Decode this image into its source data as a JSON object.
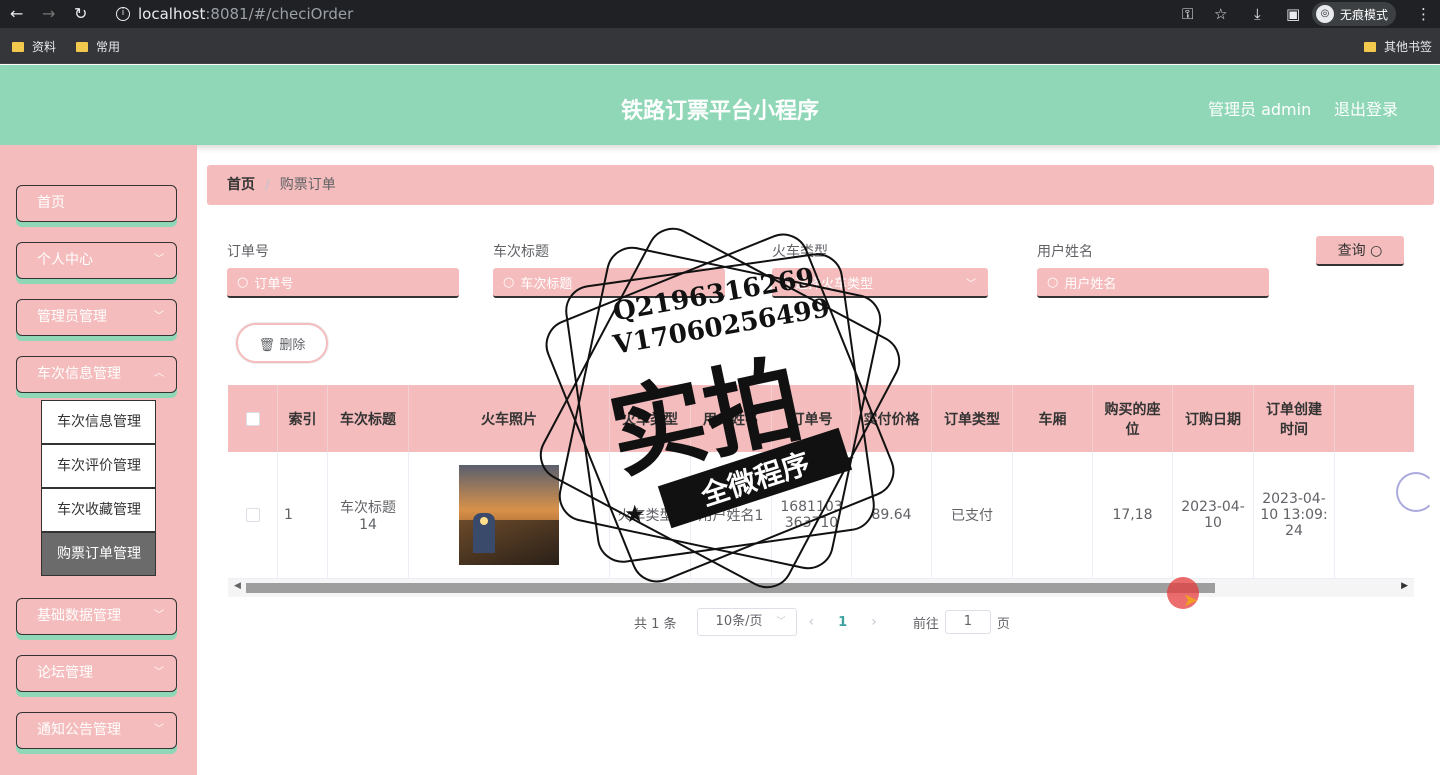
{
  "browser": {
    "url_host": "localhost",
    "url_path": ":8081/#/checiOrder",
    "incognito_label": "无痕模式",
    "bookmarks": [
      "资料",
      "常用"
    ],
    "other_bookmarks": "其他书签"
  },
  "header": {
    "title": "铁路订票平台小程序",
    "admin": "管理员 admin",
    "logout": "退出登录"
  },
  "sidebar": {
    "items": [
      {
        "label": "首页"
      },
      {
        "label": "个人中心"
      },
      {
        "label": "管理员管理"
      },
      {
        "label": "车次信息管理"
      },
      {
        "label": "基础数据管理"
      },
      {
        "label": "论坛管理"
      },
      {
        "label": "通知公告管理"
      }
    ],
    "submenu": [
      "车次信息管理",
      "车次评价管理",
      "车次收藏管理",
      "购票订单管理"
    ]
  },
  "breadcrumb": {
    "home": "首页",
    "current": "购票订单"
  },
  "filters": {
    "order_no": {
      "label": "订单号",
      "placeholder": "订单号"
    },
    "train_title": {
      "label": "车次标题",
      "placeholder": "车次标题"
    },
    "train_type": {
      "label": "火车类型",
      "placeholder": "请选择火车类型"
    },
    "user_name": {
      "label": "用户姓名",
      "placeholder": "用户姓名"
    },
    "search_label": "查询"
  },
  "actions": {
    "delete_label": "删除"
  },
  "table": {
    "columns": [
      "索引",
      "车次标题",
      "火车照片",
      "火车类型",
      "用户姓名",
      "订单号",
      "实付价格",
      "订单类型",
      "车厢",
      "购买的座位",
      "订购日期",
      "订单创建时间"
    ],
    "rows": [
      {
        "index": "1",
        "train_title": "车次标题14",
        "train_type": "火车类型2",
        "user_name": "用户姓名1",
        "order_no": "1681103363710",
        "price": "89.64",
        "order_type": "已支付",
        "carriage": "",
        "seats": "17,18",
        "order_date": "2023-04-10",
        "created_time": "2023-04-10 13:09:24"
      }
    ]
  },
  "pagination": {
    "total": "共 1 条",
    "page_size": "10条/页",
    "current_page": "1",
    "goto_label": "前往",
    "goto_value": "1",
    "page_suffix": "页"
  },
  "watermark": {
    "line1": "Q2196316269",
    "line2": "V17060256499",
    "big": "实拍",
    "banner": "全微程序"
  },
  "colors": {
    "mint": "#8fd7b7",
    "pink": "#f4bcbc"
  }
}
